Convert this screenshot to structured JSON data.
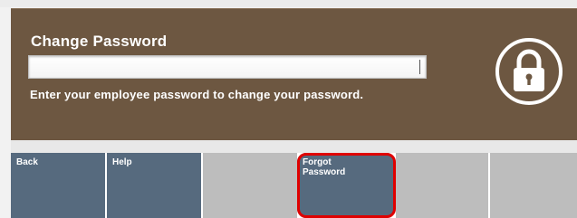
{
  "dialog": {
    "title": "Change Password",
    "password_value": "",
    "instruction": "Enter your employee password to change your password."
  },
  "icons": {
    "lock": "lock-icon"
  },
  "buttons": [
    {
      "label": "Back",
      "enabled": true
    },
    {
      "label": "Help",
      "enabled": true
    },
    {
      "label": "",
      "enabled": false
    },
    {
      "label": "Forgot Password",
      "enabled": true,
      "highlighted": true
    },
    {
      "label": "",
      "enabled": false
    },
    {
      "label": "",
      "enabled": false
    }
  ],
  "colors": {
    "panel": "#6d5741",
    "button_active": "#566a7e",
    "button_inactive": "#bdbdbd",
    "highlight": "#e00000"
  }
}
